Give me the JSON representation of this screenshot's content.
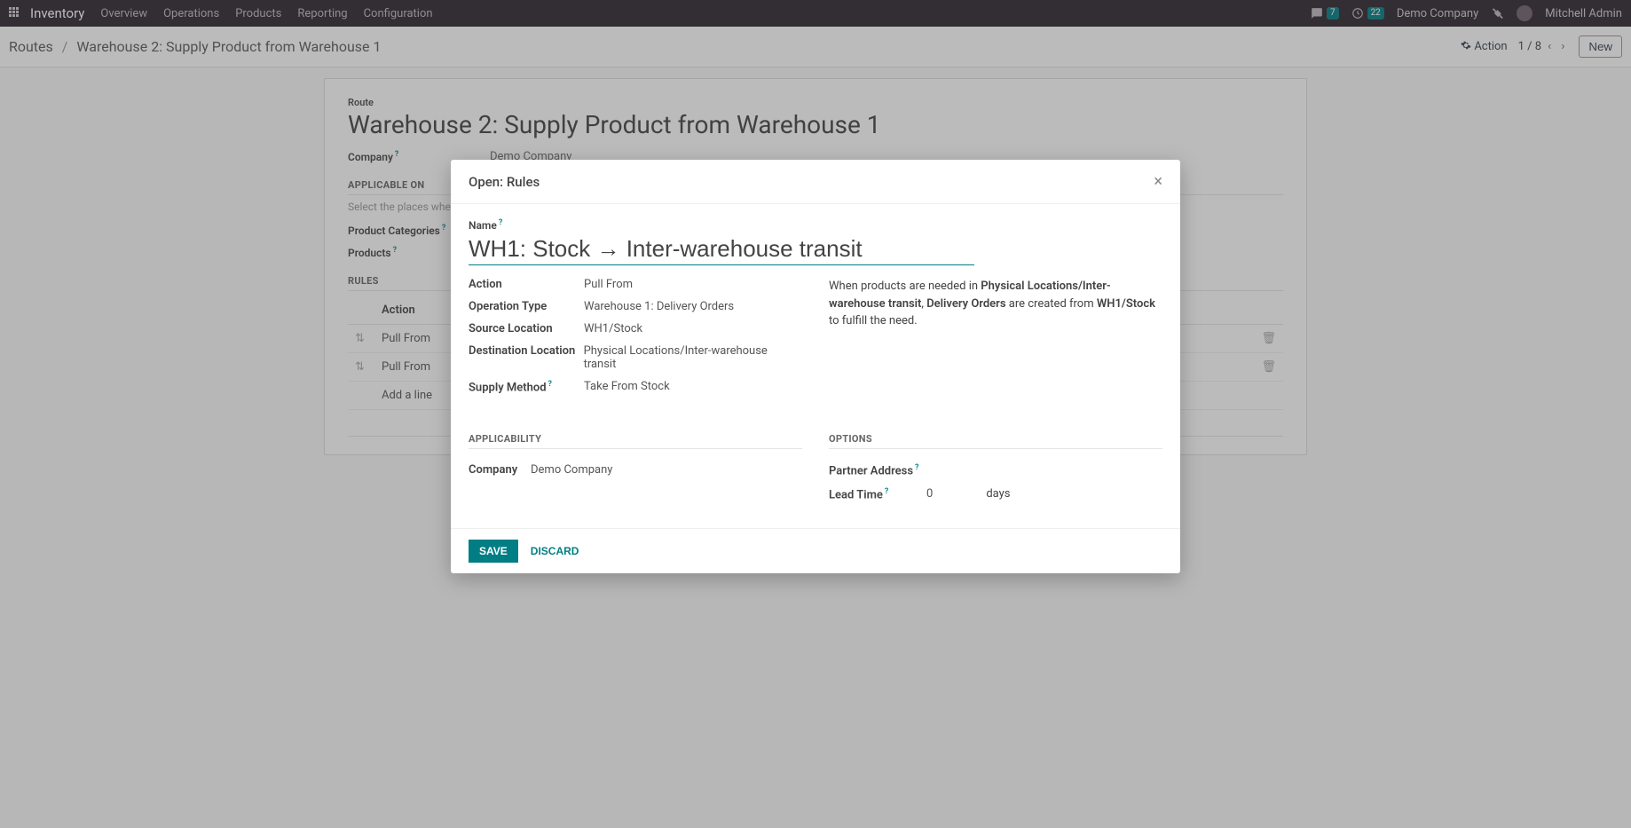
{
  "navbar": {
    "brand": "Inventory",
    "links": [
      "Overview",
      "Operations",
      "Products",
      "Reporting",
      "Configuration"
    ],
    "msg_count": "7",
    "activity_count": "22",
    "company": "Demo Company",
    "user": "Mitchell Admin"
  },
  "control": {
    "breadcrumb_root": "Routes",
    "breadcrumb_current": "Warehouse 2: Supply Product from Warehouse 1",
    "action_label": "Action",
    "pager": "1 / 8",
    "new_label": "New"
  },
  "form": {
    "route_label": "Route",
    "title": "Warehouse 2: Supply Product from Warehouse 1",
    "company_label": "Company",
    "company_value": "Demo Company",
    "applicable_on_title": "APPLICABLE ON",
    "applicable_hint": "Select the places where",
    "product_categories_label": "Product Categories",
    "products_label": "Products",
    "rules_title": "RULES",
    "rules_header_action": "Action",
    "rules": [
      {
        "action": "Pull From"
      },
      {
        "action": "Pull From"
      }
    ],
    "add_line": "Add a line"
  },
  "modal": {
    "title": "Open: Rules",
    "name_label": "Name",
    "name_value": "WH1: Stock → Inter-warehouse transit",
    "fields": {
      "action_label": "Action",
      "action_value": "Pull From",
      "optype_label": "Operation Type",
      "optype_value": "Warehouse 1: Delivery Orders",
      "srcloc_label": "Source Location",
      "srcloc_value": "WH1/Stock",
      "destloc_label": "Destination Location",
      "destloc_value": "Physical Locations/Inter-warehouse transit",
      "supply_label": "Supply Method",
      "supply_value": "Take From Stock"
    },
    "explain": {
      "pre": "When products are needed in ",
      "b1": "Physical Locations/Inter-warehouse transit",
      "mid1": ", ",
      "b2": "Delivery Orders",
      "mid2": " are created from ",
      "b3": "WH1/Stock",
      "post": " to fulfill the need."
    },
    "applicability_title": "APPLICABILITY",
    "options_title": "OPTIONS",
    "company_label": "Company",
    "company_value": "Demo Company",
    "partner_label": "Partner Address",
    "leadtime_label": "Lead Time",
    "leadtime_value": "0",
    "leadtime_unit": "days",
    "save": "SAVE",
    "discard": "DISCARD"
  }
}
